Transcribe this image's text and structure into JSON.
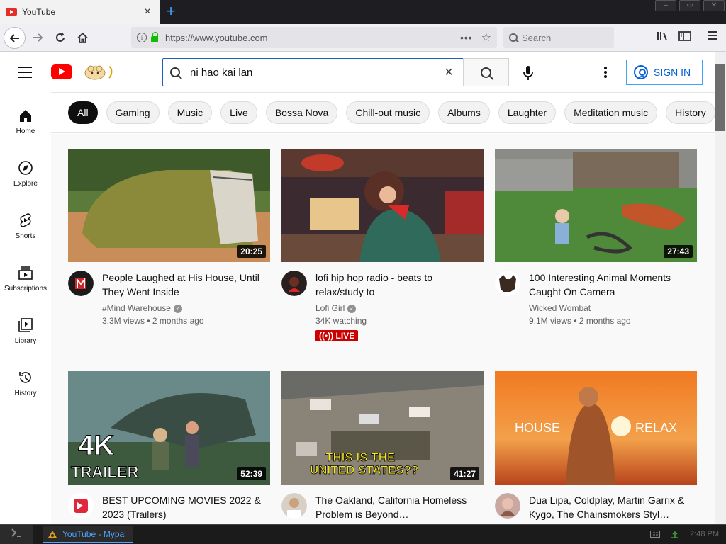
{
  "browser": {
    "tab_title": "YouTube",
    "tab_close": "×",
    "new_tab": "+",
    "url": "https://www.youtube.com",
    "search_placeholder": "Search",
    "url_actions_dots": "•••",
    "bookmark_star": "☆"
  },
  "header": {
    "search_query": "ni hao kai lan",
    "clear_glyph": "×",
    "sign_in_label": "SIGN IN"
  },
  "chips": [
    "All",
    "Gaming",
    "Music",
    "Live",
    "Bossa Nova",
    "Chill-out music",
    "Albums",
    "Laughter",
    "Meditation music",
    "History"
  ],
  "guide": [
    {
      "label": "Home",
      "icon": "home-icon"
    },
    {
      "label": "Explore",
      "icon": "compass-icon"
    },
    {
      "label": "Shorts",
      "icon": "shorts-icon"
    },
    {
      "label": "Subscriptions",
      "icon": "subscriptions-icon"
    },
    {
      "label": "Library",
      "icon": "library-icon"
    },
    {
      "label": "History",
      "icon": "history-icon"
    }
  ],
  "videos": [
    {
      "title": "People Laughed at His House, Until They Went Inside",
      "channel": "#Mind Warehouse",
      "verified": true,
      "stats": "3.3M views • 2 months ago",
      "duration": "20:25"
    },
    {
      "title": "lofi hip hop radio - beats to relax/study to",
      "channel": "Lofi Girl",
      "verified": true,
      "stats": "34K watching",
      "live_label": "LIVE"
    },
    {
      "title": "100 Interesting Animal Moments Caught On Camera",
      "channel": "Wicked Wombat",
      "verified": false,
      "stats": "9.1M views • 2 months ago",
      "duration": "27:43"
    },
    {
      "title": "BEST UPCOMING MOVIES 2022 & 2023 (Trailers)",
      "duration": "52:39",
      "thumb_text": [
        "4K",
        "TRAILER"
      ]
    },
    {
      "title": "The Oakland, California Homeless Problem is Beyond…",
      "duration": "41:27",
      "thumb_text": [
        "THIS IS THE",
        "UNITED STATES??"
      ]
    },
    {
      "title": "Dua Lipa, Coldplay, Martin Garrix & Kygo, The Chainsmokers Styl…",
      "thumb_text": [
        "HOUSE",
        "RELAX"
      ]
    }
  ],
  "taskbar": {
    "app_label": "YouTube - Mypal",
    "clock": "2:48 PM"
  },
  "colors": {
    "youtube_red": "#ff0000",
    "link_blue": "#065fd4",
    "live_red": "#cc0000"
  }
}
